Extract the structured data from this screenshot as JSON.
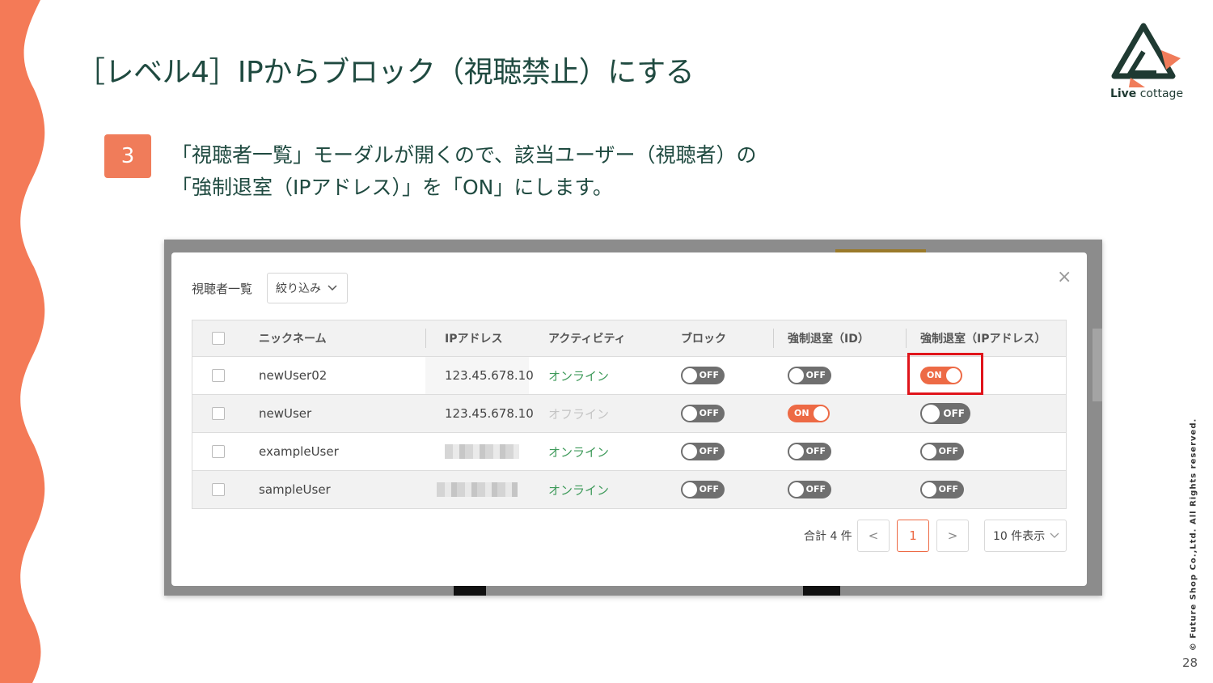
{
  "slide": {
    "title": "［レベル4］IPからブロック（視聴禁止）にする",
    "step_number": "3",
    "step_line1": "「視聴者一覧」モーダルが開くので、該当ユーザー（視聴者）の",
    "step_line2": "「強制退室（IPアドレス）」を「ON」にします。",
    "logo_bold": "Live",
    "logo_rest": " cottage",
    "copyright": "© Future Shop Co.,Ltd. All Rights reserved.",
    "page_number": "28",
    "colors": {
      "accent": "#f07c5a",
      "title": "#1f4a40",
      "toggle_on": "#ed6a45",
      "toggle_off": "#6f6f6f",
      "highlight": "#e0141b",
      "online": "#3e9a5a"
    }
  },
  "modal": {
    "title": "視聴者一覧",
    "filter_label": "絞り込み",
    "filter_icon": "chevron-down-icon",
    "close_icon": "close-icon",
    "close_glyph": "×",
    "columns": [
      "ニックネーム",
      "IPアドレス",
      "アクティビティ",
      "ブロック",
      "強制退室（ID）",
      "強制退室（IPアドレス）"
    ],
    "rows": [
      {
        "nickname": "newUser02",
        "ip": "123.45.678.10",
        "activity": "オンライン",
        "block": "OFF",
        "kick_id": "OFF",
        "kick_ip": "ON"
      },
      {
        "nickname": "newUser",
        "ip": "123.45.678.10",
        "activity": "オフライン",
        "block": "OFF",
        "kick_id": "ON",
        "kick_ip": "OFF"
      },
      {
        "nickname": "exampleUser",
        "ip": "",
        "activity": "オンライン",
        "block": "OFF",
        "kick_id": "OFF",
        "kick_ip": "OFF"
      },
      {
        "nickname": "sampleUser",
        "ip": "",
        "activity": "オンライン",
        "block": "OFF",
        "kick_id": "OFF",
        "kick_ip": "OFF"
      }
    ],
    "pagination": {
      "total": "合計 4 件",
      "prev": "<",
      "current": "1",
      "next": ">",
      "per_page": "10 件表示"
    }
  }
}
